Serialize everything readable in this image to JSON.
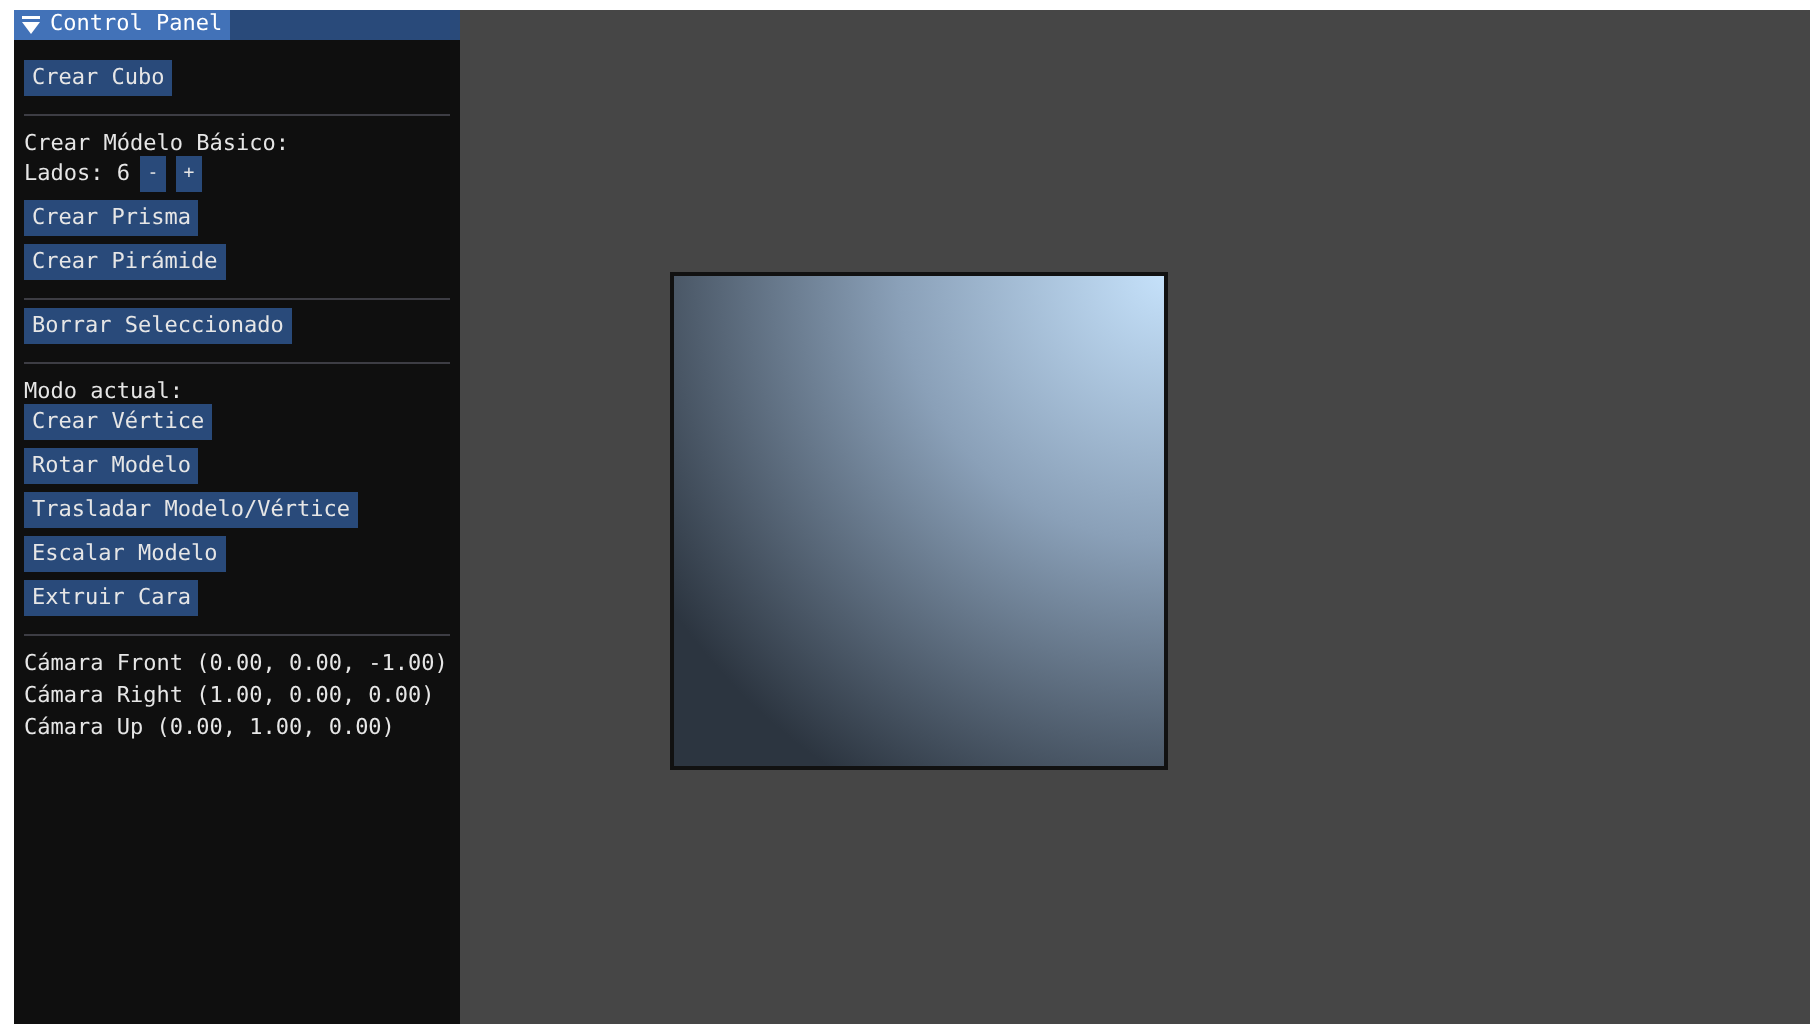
{
  "panel": {
    "title": "Control Panel",
    "items": [
      {
        "kind": "button",
        "label": "Crear Cubo"
      },
      {
        "kind": "separator"
      },
      {
        "kind": "text",
        "text": "Crear Módelo Básico:"
      },
      {
        "kind": "stepper",
        "label": "Lados: 6",
        "buttons": [
          "-",
          "+"
        ]
      },
      {
        "kind": "button",
        "label": "Crear Prisma"
      },
      {
        "kind": "button",
        "label": "Crear Pirámide"
      },
      {
        "kind": "separator"
      },
      {
        "kind": "button",
        "label": "Borrar Seleccionado"
      },
      {
        "kind": "separator"
      },
      {
        "kind": "text",
        "text": "Modo actual:"
      },
      {
        "kind": "button",
        "label": "Crear Vértice"
      },
      {
        "kind": "button",
        "label": "Rotar Modelo"
      },
      {
        "kind": "button",
        "label": "Trasladar Modelo/Vértice"
      },
      {
        "kind": "button",
        "label": "Escalar Modelo"
      },
      {
        "kind": "button",
        "label": "Extruir Cara"
      },
      {
        "kind": "separator"
      },
      {
        "kind": "text",
        "text": "Cámara Front (0.00, 0.00, -1.00)"
      },
      {
        "kind": "text",
        "text": "Cámara Right (1.00, 0.00, 0.00)"
      },
      {
        "kind": "text",
        "text": "Cámara Up (0.00, 1.00, 0.00)"
      }
    ]
  }
}
